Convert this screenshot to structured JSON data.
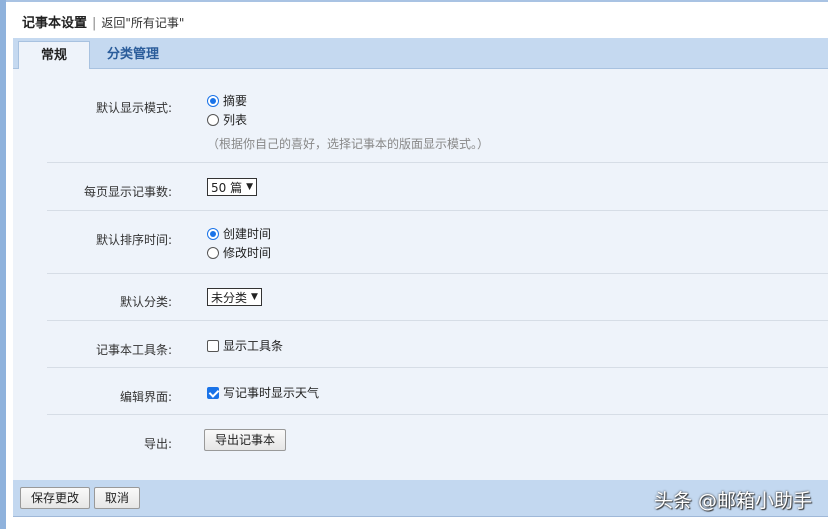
{
  "header": {
    "title": "记事本设置",
    "separator": "|",
    "back_link": "返回\"所有记事\""
  },
  "tabs": [
    {
      "label": "常规",
      "active": true
    },
    {
      "label": "分类管理",
      "active": false
    }
  ],
  "settings": {
    "display_mode": {
      "label": "默认显示模式:",
      "options": [
        "摘要",
        "列表"
      ],
      "selected": "摘要",
      "hint": "（根据你自己的喜好，选择记事本的版面显示模式。）"
    },
    "per_page": {
      "label": "每页显示记事数:",
      "value": "50 篇"
    },
    "sort_time": {
      "label": "默认排序时间:",
      "options": [
        "创建时间",
        "修改时间"
      ],
      "selected": "创建时间"
    },
    "default_category": {
      "label": "默认分类:",
      "value": "未分类"
    },
    "toolbar": {
      "label": "记事本工具条:",
      "option": "显示工具条",
      "checked": false
    },
    "editor": {
      "label": "编辑界面:",
      "option": "写记事时显示天气",
      "checked": true
    },
    "export": {
      "label": "导出:",
      "button": "导出记事本"
    }
  },
  "footer": {
    "save": "保存更改",
    "cancel": "取消"
  },
  "watermark": "头条 @邮箱小助手"
}
